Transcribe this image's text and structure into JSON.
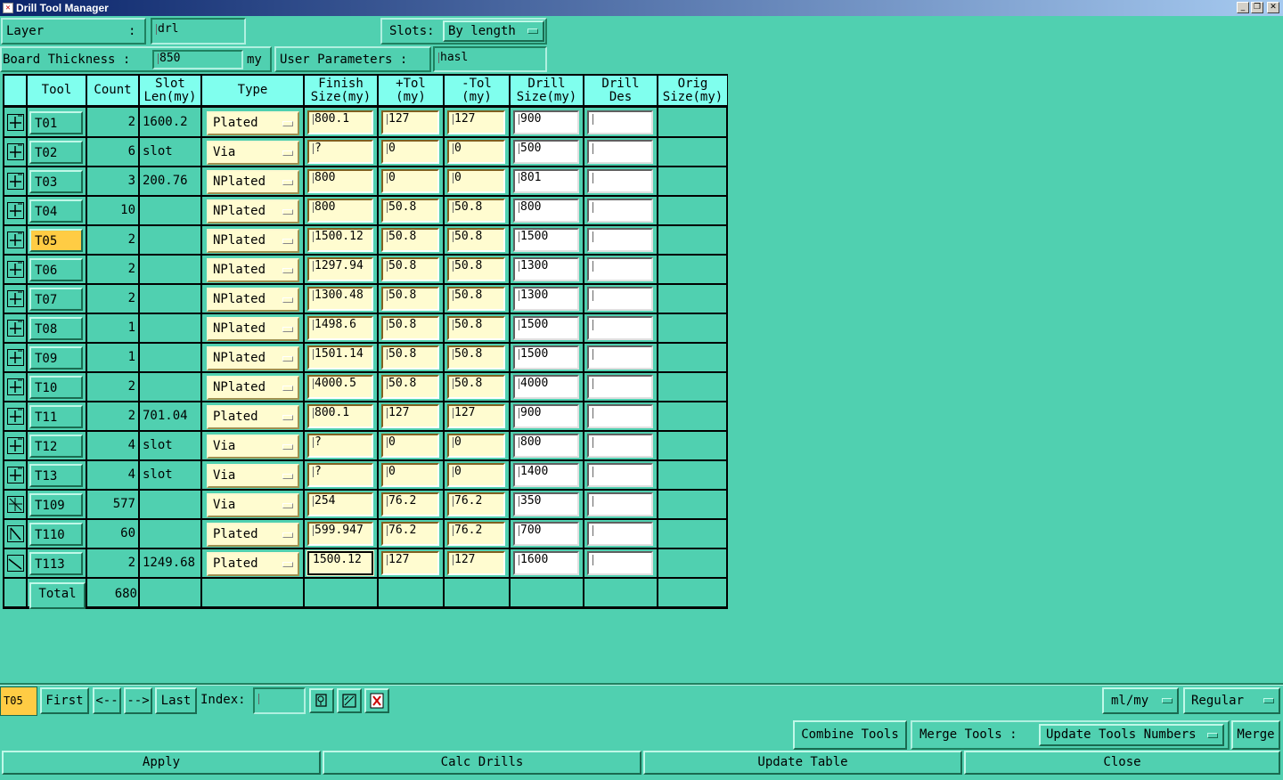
{
  "window": {
    "title": "Drill Tool Manager",
    "controls": {
      "minimize": "_",
      "restore": "❐",
      "close": "✕"
    }
  },
  "header": {
    "layer_label": "Layer",
    "layer_colon": ":",
    "layer_value": "drl",
    "slots_label": "Slots:",
    "slots_value": "By length",
    "board_thickness_label": "Board Thickness :",
    "board_thickness_value": "850",
    "board_thickness_unit": "my",
    "user_params_label": "User Parameters :",
    "user_params_value": "hasl"
  },
  "table": {
    "columns": {
      "tool": "Tool",
      "count": "Count",
      "slot_len_1": "Slot",
      "slot_len_2": "Len(my)",
      "type": "Type",
      "finish_1": "Finish",
      "finish_2": "Size(my)",
      "ptol_1": "+Tol",
      "ptol_2": "(my)",
      "ntol_1": "-Tol",
      "ntol_2": "(my)",
      "drill_1": "Drill",
      "drill_2": "Size(my)",
      "des_1": "Drill",
      "des_2": "Des",
      "orig_1": "Orig",
      "orig_2": "Size(my)"
    },
    "rows": [
      {
        "tool": "T01",
        "count": "2",
        "slot_len": "1600.2",
        "type": "Plated",
        "finish": "800.1",
        "ptol": "127",
        "ntol": "127",
        "drill": "900",
        "des": "",
        "orig": ""
      },
      {
        "tool": "T02",
        "count": "6",
        "slot_len": "slot",
        "type": "Via",
        "finish": "?",
        "ptol": "0",
        "ntol": "0",
        "drill": "500",
        "des": "",
        "orig": ""
      },
      {
        "tool": "T03",
        "count": "3",
        "slot_len": "200.76",
        "type": "NPlated",
        "finish": "800",
        "ptol": "0",
        "ntol": "0",
        "drill": "801",
        "des": "",
        "orig": ""
      },
      {
        "tool": "T04",
        "count": "10",
        "slot_len": "",
        "type": "NPlated",
        "finish": "800",
        "ptol": "50.8",
        "ntol": "50.8",
        "drill": "800",
        "des": "",
        "orig": ""
      },
      {
        "tool": "T05",
        "count": "2",
        "slot_len": "",
        "type": "NPlated",
        "finish": "1500.12",
        "ptol": "50.8",
        "ntol": "50.8",
        "drill": "1500",
        "des": "",
        "orig": ""
      },
      {
        "tool": "T06",
        "count": "2",
        "slot_len": "",
        "type": "NPlated",
        "finish": "1297.94",
        "ptol": "50.8",
        "ntol": "50.8",
        "drill": "1300",
        "des": "",
        "orig": ""
      },
      {
        "tool": "T07",
        "count": "2",
        "slot_len": "",
        "type": "NPlated",
        "finish": "1300.48",
        "ptol": "50.8",
        "ntol": "50.8",
        "drill": "1300",
        "des": "",
        "orig": ""
      },
      {
        "tool": "T08",
        "count": "1",
        "slot_len": "",
        "type": "NPlated",
        "finish": "1498.6",
        "ptol": "50.8",
        "ntol": "50.8",
        "drill": "1500",
        "des": "",
        "orig": ""
      },
      {
        "tool": "T09",
        "count": "1",
        "slot_len": "",
        "type": "NPlated",
        "finish": "1501.14",
        "ptol": "50.8",
        "ntol": "50.8",
        "drill": "1500",
        "des": "",
        "orig": ""
      },
      {
        "tool": "T10",
        "count": "2",
        "slot_len": "",
        "type": "NPlated",
        "finish": "4000.5",
        "ptol": "50.8",
        "ntol": "50.8",
        "drill": "4000",
        "des": "",
        "orig": ""
      },
      {
        "tool": "T11",
        "count": "2",
        "slot_len": "701.04",
        "type": "Plated",
        "finish": "800.1",
        "ptol": "127",
        "ntol": "127",
        "drill": "900",
        "des": "",
        "orig": ""
      },
      {
        "tool": "T12",
        "count": "4",
        "slot_len": "slot",
        "type": "Via",
        "finish": "?",
        "ptol": "0",
        "ntol": "0",
        "drill": "800",
        "des": "",
        "orig": ""
      },
      {
        "tool": "T13",
        "count": "4",
        "slot_len": "slot",
        "type": "Via",
        "finish": "?",
        "ptol": "0",
        "ntol": "0",
        "drill": "1400",
        "des": "",
        "orig": ""
      },
      {
        "tool": "T109",
        "count": "577",
        "slot_len": "",
        "type": "Via",
        "finish": "254",
        "ptol": "76.2",
        "ntol": "76.2",
        "drill": "350",
        "des": "",
        "orig": ""
      },
      {
        "tool": "T110",
        "count": "60",
        "slot_len": "",
        "type": "Plated",
        "finish": "599.947",
        "ptol": "76.2",
        "ntol": "76.2",
        "drill": "700",
        "des": "",
        "orig": ""
      },
      {
        "tool": "T113",
        "count": "2",
        "slot_len": "1249.68",
        "type": "Plated",
        "finish": "1500.12",
        "ptol": "127",
        "ntol": "127",
        "drill": "1600",
        "des": "",
        "orig": ""
      }
    ],
    "total_label": "Total",
    "total_count": "680",
    "selected_tool": "T05"
  },
  "nav": {
    "current_tool": "T05",
    "first": "First",
    "prev": "<--",
    "next": "-->",
    "last": "Last",
    "index_label": "Index:",
    "index_value": "",
    "units_value": "ml/my",
    "mode_value": "Regular"
  },
  "merge": {
    "combine_tools": "Combine Tools",
    "merge_tools_label": "Merge Tools :",
    "merge_option": "Update Tools Numbers",
    "merge_button": "Merge"
  },
  "footer": {
    "apply": "Apply",
    "calc_drills": "Calc Drills",
    "update_table": "Update Table",
    "close": "Close"
  },
  "colors": {
    "background": "#50d0b0",
    "header_cells": "#80ffee",
    "editable_cells": "#fffcd0",
    "selected_tool": "#ffcc44"
  }
}
